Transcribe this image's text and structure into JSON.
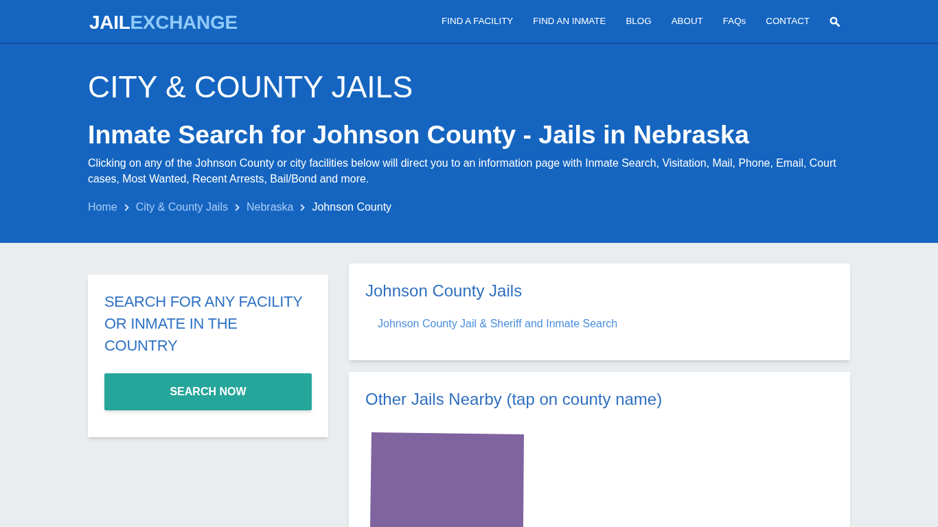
{
  "header": {
    "logo_parts": [
      "JAIL",
      "EXCHANGE"
    ],
    "nav": [
      "FIND A FACILITY",
      "FIND AN INMATE",
      "BLOG",
      "ABOUT",
      "FAQs",
      "CONTACT"
    ]
  },
  "hero": {
    "title": "CITY & COUNTY JAILS",
    "subtitle": "Inmate Search for Johnson County - Jails in Nebraska",
    "description": "Clicking on any of the Johnson County or city facilities below will direct you to an information page with Inmate Search, Visitation, Mail, Phone, Email, Court cases, Most Wanted, Recent Arrests, Bail/Bond and more.",
    "breadcrumb": [
      {
        "label": "Home",
        "current": false
      },
      {
        "label": "City & County Jails",
        "current": false
      },
      {
        "label": "Nebraska",
        "current": false
      },
      {
        "label": "Johnson County",
        "current": true
      }
    ]
  },
  "sidebar_card": {
    "heading": "SEARCH FOR ANY FACILITY OR INMATE IN THE COUNTRY",
    "button": "SEARCH NOW"
  },
  "jails_card": {
    "title": "Johnson County Jails",
    "links": [
      "Johnson County Jail & Sheriff and Inmate Search"
    ]
  },
  "nearby_card": {
    "title": "Other Jails Nearby (tap on county name)",
    "map": {
      "counties": [
        {
          "color": "#80649f"
        }
      ]
    }
  }
}
